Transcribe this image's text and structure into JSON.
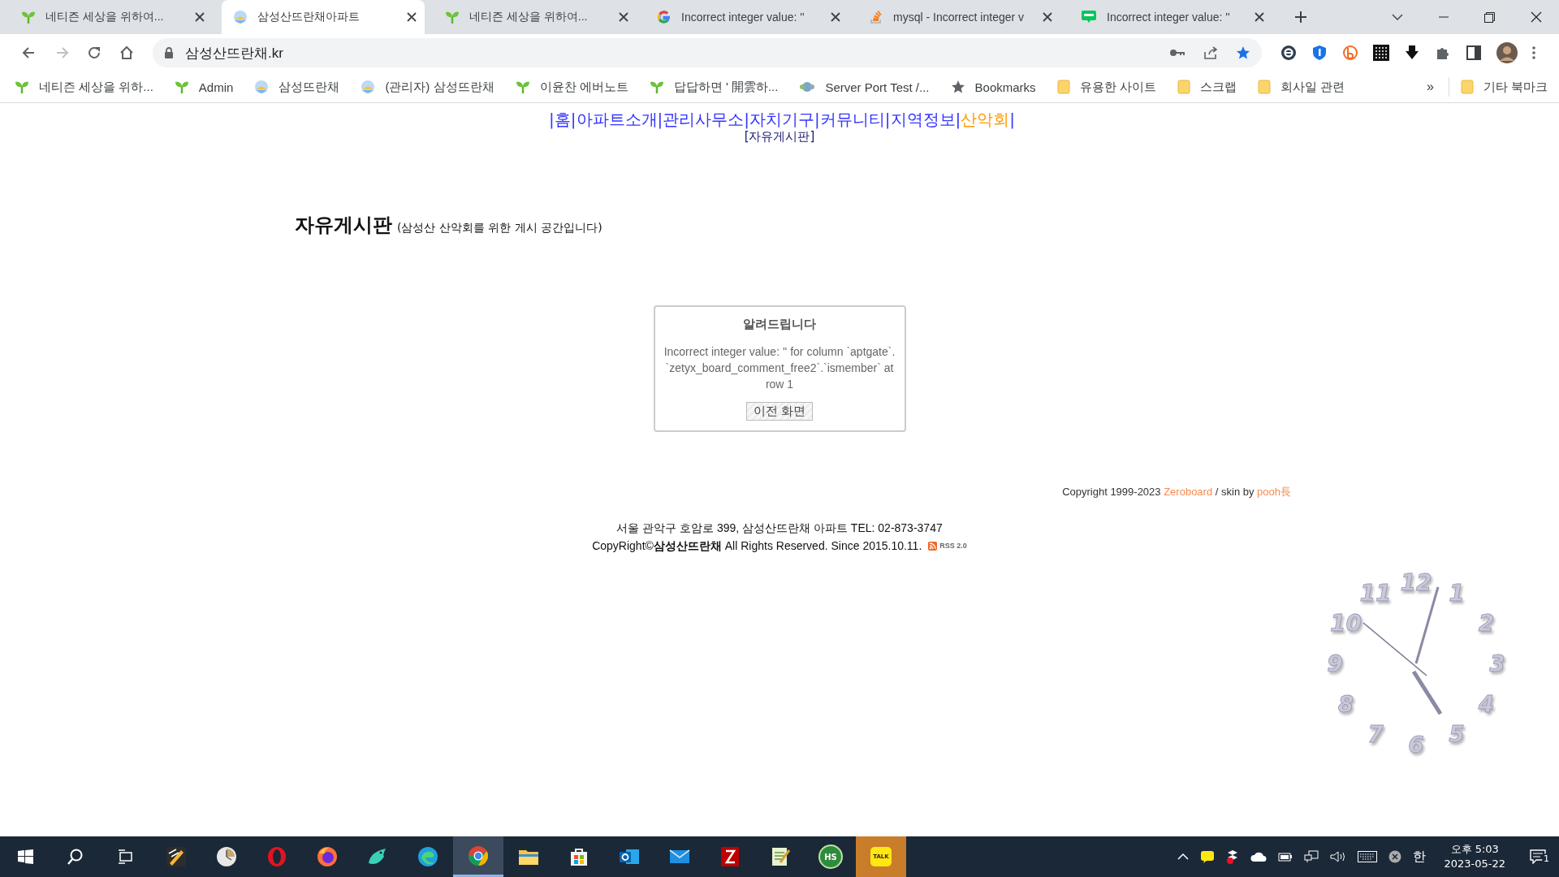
{
  "tabs": [
    {
      "kind": "sprout",
      "title": "네티즌 세상을 위하여...",
      "selected": false
    },
    {
      "kind": "globe",
      "title": "삼성산뜨란채아파트",
      "selected": true
    },
    {
      "kind": "sprout",
      "title": "네티즌 세상을 위하여...",
      "selected": false
    },
    {
      "kind": "google",
      "title": "Incorrect integer value: ''",
      "selected": false
    },
    {
      "kind": "stack",
      "title": "mysql - Incorrect integer v",
      "selected": false
    },
    {
      "kind": "blog",
      "title": "Incorrect integer value: ''",
      "selected": false
    }
  ],
  "address": "삼성산뜨란채.kr",
  "bookmarks": [
    {
      "kind": "sprout",
      "label": "네티즌 세상을 위하..."
    },
    {
      "kind": "sprout",
      "label": "Admin"
    },
    {
      "kind": "globe",
      "label": "삼성뜨란채"
    },
    {
      "kind": "globe",
      "label": "(관리자) 삼성뜨란채"
    },
    {
      "kind": "sprout",
      "label": "이윤찬 에버노트"
    },
    {
      "kind": "sprout",
      "label": "답답하면 ' 開雲하..."
    },
    {
      "kind": "network",
      "label": "Server Port Test /..."
    },
    {
      "kind": "star",
      "label": "Bookmarks"
    },
    {
      "kind": "folder",
      "label": "유용한 사이트"
    },
    {
      "kind": "folder",
      "label": "스크랩"
    },
    {
      "kind": "folder",
      "label": "회사일 관련"
    }
  ],
  "bookmarks_more": "»",
  "other_bookmarks": "기타 북마크",
  "nav": [
    {
      "kind": "separator",
      "text": "|"
    },
    {
      "kind": "link",
      "text": "홈",
      "selected": false
    },
    {
      "kind": "separator",
      "text": "|"
    },
    {
      "kind": "link",
      "text": "아파트소개",
      "selected": false
    },
    {
      "kind": "separator",
      "text": "|"
    },
    {
      "kind": "link",
      "text": "관리사무소",
      "selected": false
    },
    {
      "kind": "separator",
      "text": "|"
    },
    {
      "kind": "link",
      "text": "자치기구",
      "selected": false
    },
    {
      "kind": "separator",
      "text": "|"
    },
    {
      "kind": "link",
      "text": "커뮤니티",
      "selected": false
    },
    {
      "kind": "separator",
      "text": "|"
    },
    {
      "kind": "link",
      "text": "지역정보",
      "selected": false
    },
    {
      "kind": "separator",
      "text": "|"
    },
    {
      "kind": "link",
      "text": "산악회",
      "selected": true
    },
    {
      "kind": "separator",
      "text": "|"
    }
  ],
  "subnav": "[자유게시판]",
  "board": {
    "title": "자유게시판",
    "subtitle": "(삼성산 산악회를 위한 게시 공간입니다)"
  },
  "dialog": {
    "title": "알려드립니다",
    "message": "Incorrect integer value: '' for column `aptgate`.`zetyx_board_comment_free2`.`ismember` at row 1",
    "button": "이전 화면"
  },
  "credit": {
    "prefix": "Copyright 1999-2023",
    "link": "Zeroboard",
    "middle": "/ skin by",
    "author": "pooh長"
  },
  "footer": {
    "address": "서울 관악구 호암로 399, 삼성산뜨란채 아파트 TEL: 02-873-3747",
    "copyright": "CopyRight©**삼성산뜨란채** All Rights Reserved. Since 2015.10.11.",
    "rss": "RSS 2.0"
  },
  "clock": {
    "numerals": [
      "12",
      "11",
      "1",
      "10",
      "2",
      "9",
      "3",
      "8",
      "4",
      "7",
      "5",
      "6"
    ]
  },
  "taskbar": {
    "apps": [
      {
        "kind": "pen",
        "selected": false,
        "attention": false
      },
      {
        "kind": "clock",
        "selected": false,
        "attention": false
      },
      {
        "kind": "opera",
        "selected": false,
        "attention": false
      },
      {
        "kind": "firefox",
        "selected": false,
        "attention": false
      },
      {
        "kind": "bird",
        "selected": false,
        "attention": false
      },
      {
        "kind": "edge",
        "selected": false,
        "attention": false
      },
      {
        "kind": "chrome",
        "selected": true,
        "attention": false
      },
      {
        "kind": "files",
        "selected": false,
        "attention": false
      },
      {
        "kind": "store",
        "selected": false,
        "attention": false
      },
      {
        "kind": "outlook",
        "selected": false,
        "attention": false
      },
      {
        "kind": "mail",
        "selected": false,
        "attention": false
      },
      {
        "kind": "filezilla",
        "selected": false,
        "attention": false
      },
      {
        "kind": "notepad",
        "selected": false,
        "attention": false
      },
      {
        "kind": "hs",
        "label": "HS",
        "selected": false,
        "attention": false
      },
      {
        "kind": "talk",
        "label": "TALK",
        "selected": false,
        "attention": true
      }
    ],
    "ime": "한",
    "time": "오후 5:03",
    "date": "2023-05-22",
    "notifications": "1"
  }
}
